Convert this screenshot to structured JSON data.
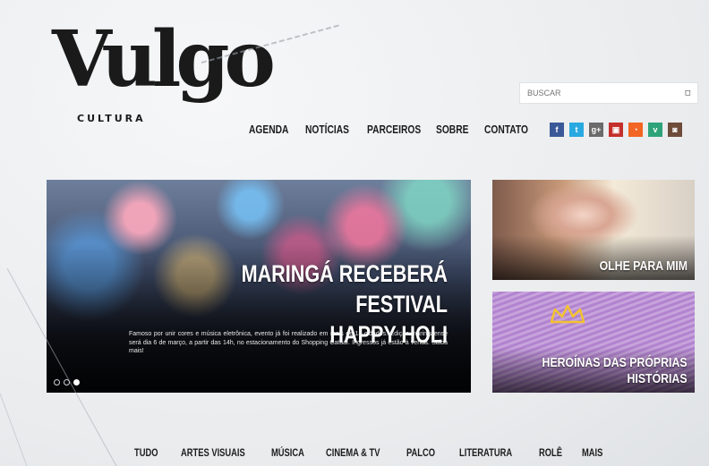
{
  "logo": {
    "word": "Vulgo",
    "sub": "CULTURA"
  },
  "search": {
    "placeholder": "BUSCAR",
    "button": "□"
  },
  "nav": [
    "AGENDA",
    "NOTÍCIAS",
    "PARCEIROS",
    "SOBRE",
    "CONTATO"
  ],
  "social": [
    {
      "icon": "facebook-icon",
      "glyph": "f",
      "color": "#3b5998"
    },
    {
      "icon": "twitter-icon",
      "glyph": "t",
      "color": "#29a9e1"
    },
    {
      "icon": "googleplus-icon",
      "glyph": "g+",
      "color": "#6b6b6b"
    },
    {
      "icon": "youtube-icon",
      "glyph": "▣",
      "color": "#c4302b"
    },
    {
      "icon": "rss-icon",
      "glyph": "◔",
      "color": "#f26522"
    },
    {
      "icon": "vimeo-icon",
      "glyph": "v",
      "color": "#2ea37a"
    },
    {
      "icon": "instagram-icon",
      "glyph": "◙",
      "color": "#6d4c3a"
    }
  ],
  "hero": {
    "title_line1": "MARINGÁ RECEBERÁ FESTIVAL",
    "title_line2": "HAPPY HOLI",
    "description": "Famoso por unir cores e música eletrônica, evento já foi realizado em mais de 15 cidades. Edição maringaense será dia 6 de março, a partir das 14h, no estacionamento do Shopping Catuaí. Ingressos já estão à venda. Saiba mais!",
    "slides": 3,
    "active_slide": 3
  },
  "cards": [
    {
      "title_line1": "OLHE PARA MIM",
      "title_line2": ""
    },
    {
      "title_line1": "HEROÍNAS DAS PRÓPRIAS",
      "title_line2": "HISTÓRIAS"
    }
  ],
  "categories": [
    "TUDO",
    "ARTES VISUAIS",
    "MÚSICA",
    "CINEMA & TV",
    "PALCO",
    "LITERATURA",
    "ROLÊ",
    "MAIS"
  ],
  "colors": {
    "text": "#1c1c1c",
    "background": "#eceef0",
    "accent_purple": "#b88ad3"
  }
}
